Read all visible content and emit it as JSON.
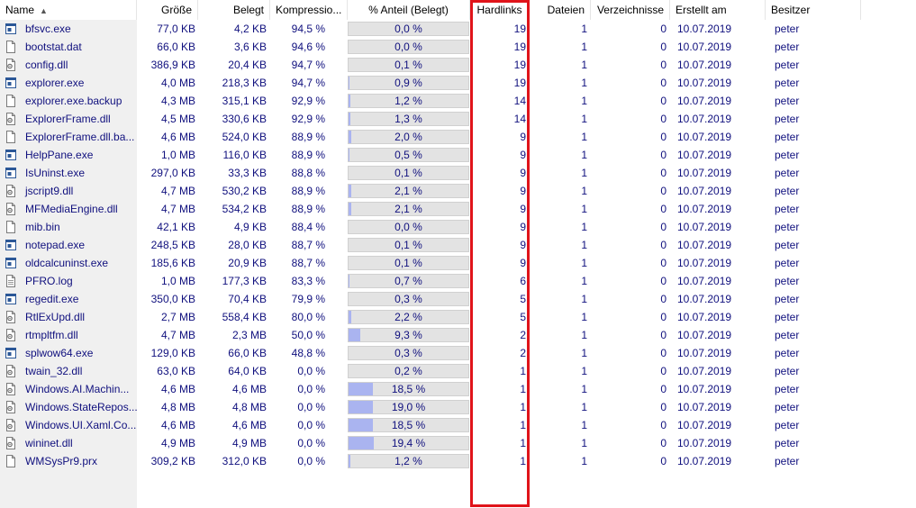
{
  "columns": {
    "name": "Name",
    "size": "Größe",
    "allocated": "Belegt",
    "compression": "Kompressio...",
    "share": "% Anteil (Belegt)",
    "hardlinks": "Hardlinks",
    "files": "Dateien",
    "directories": "Verzeichnisse",
    "created": "Erstellt am",
    "owner": "Besitzer"
  },
  "sort": {
    "column": "name",
    "direction": "ascending"
  },
  "accent_colors": {
    "text": "#10107e",
    "bar": "#aab4f0",
    "highlight": "#e0141a"
  },
  "rows": [
    {
      "icon": "app-file-icon",
      "name": "bfsvc.exe",
      "size": "77,0 KB",
      "allocated": "4,2 KB",
      "compression": "94,5 %",
      "share": "0,0 %",
      "share_value": 0.0,
      "hardlinks": "19",
      "files": "1",
      "directories": "0",
      "created": "10.07.2019",
      "owner": "peter"
    },
    {
      "icon": "text-file-icon",
      "name": "bootstat.dat",
      "size": "66,0 KB",
      "allocated": "3,6 KB",
      "compression": "94,6 %",
      "share": "0,0 %",
      "share_value": 0.0,
      "hardlinks": "19",
      "files": "1",
      "directories": "0",
      "created": "10.07.2019",
      "owner": "peter"
    },
    {
      "icon": "dll-file-icon",
      "name": "config.dll",
      "size": "386,9 KB",
      "allocated": "20,4 KB",
      "compression": "94,7 %",
      "share": "0,1 %",
      "share_value": 0.1,
      "hardlinks": "19",
      "files": "1",
      "directories": "0",
      "created": "10.07.2019",
      "owner": "peter"
    },
    {
      "icon": "app-file-icon",
      "name": "explorer.exe",
      "size": "4,0 MB",
      "allocated": "218,3 KB",
      "compression": "94,7 %",
      "share": "0,9 %",
      "share_value": 0.9,
      "hardlinks": "19",
      "files": "1",
      "directories": "0",
      "created": "10.07.2019",
      "owner": "peter"
    },
    {
      "icon": "text-file-icon",
      "name": "explorer.exe.backup",
      "size": "4,3 MB",
      "allocated": "315,1 KB",
      "compression": "92,9 %",
      "share": "1,2 %",
      "share_value": 1.2,
      "hardlinks": "14",
      "files": "1",
      "directories": "0",
      "created": "10.07.2019",
      "owner": "peter"
    },
    {
      "icon": "dll-file-icon",
      "name": "ExplorerFrame.dll",
      "size": "4,5 MB",
      "allocated": "330,6 KB",
      "compression": "92,9 %",
      "share": "1,3 %",
      "share_value": 1.3,
      "hardlinks": "14",
      "files": "1",
      "directories": "0",
      "created": "10.07.2019",
      "owner": "peter"
    },
    {
      "icon": "text-file-icon",
      "name": "ExplorerFrame.dll.ba...",
      "size": "4,6 MB",
      "allocated": "524,0 KB",
      "compression": "88,9 %",
      "share": "2,0 %",
      "share_value": 2.0,
      "hardlinks": "9",
      "files": "1",
      "directories": "0",
      "created": "10.07.2019",
      "owner": "peter"
    },
    {
      "icon": "app-file-icon",
      "name": "HelpPane.exe",
      "size": "1,0 MB",
      "allocated": "116,0 KB",
      "compression": "88,9 %",
      "share": "0,5 %",
      "share_value": 0.5,
      "hardlinks": "9",
      "files": "1",
      "directories": "0",
      "created": "10.07.2019",
      "owner": "peter"
    },
    {
      "icon": "app-file-icon",
      "name": "IsUninst.exe",
      "size": "297,0 KB",
      "allocated": "33,3 KB",
      "compression": "88,8 %",
      "share": "0,1 %",
      "share_value": 0.1,
      "hardlinks": "9",
      "files": "1",
      "directories": "0",
      "created": "10.07.2019",
      "owner": "peter"
    },
    {
      "icon": "dll-file-icon",
      "name": "jscript9.dll",
      "size": "4,7 MB",
      "allocated": "530,2 KB",
      "compression": "88,9 %",
      "share": "2,1 %",
      "share_value": 2.1,
      "hardlinks": "9",
      "files": "1",
      "directories": "0",
      "created": "10.07.2019",
      "owner": "peter"
    },
    {
      "icon": "dll-file-icon",
      "name": "MFMediaEngine.dll",
      "size": "4,7 MB",
      "allocated": "534,2 KB",
      "compression": "88,9 %",
      "share": "2,1 %",
      "share_value": 2.1,
      "hardlinks": "9",
      "files": "1",
      "directories": "0",
      "created": "10.07.2019",
      "owner": "peter"
    },
    {
      "icon": "text-file-icon",
      "name": "mib.bin",
      "size": "42,1 KB",
      "allocated": "4,9 KB",
      "compression": "88,4 %",
      "share": "0,0 %",
      "share_value": 0.0,
      "hardlinks": "9",
      "files": "1",
      "directories": "0",
      "created": "10.07.2019",
      "owner": "peter"
    },
    {
      "icon": "app-file-icon",
      "name": "notepad.exe",
      "size": "248,5 KB",
      "allocated": "28,0 KB",
      "compression": "88,7 %",
      "share": "0,1 %",
      "share_value": 0.1,
      "hardlinks": "9",
      "files": "1",
      "directories": "0",
      "created": "10.07.2019",
      "owner": "peter"
    },
    {
      "icon": "app-file-icon",
      "name": "oldcalcuninst.exe",
      "size": "185,6 KB",
      "allocated": "20,9 KB",
      "compression": "88,7 %",
      "share": "0,1 %",
      "share_value": 0.1,
      "hardlinks": "9",
      "files": "1",
      "directories": "0",
      "created": "10.07.2019",
      "owner": "peter"
    },
    {
      "icon": "log-file-icon",
      "name": "PFRO.log",
      "size": "1,0 MB",
      "allocated": "177,3 KB",
      "compression": "83,3 %",
      "share": "0,7 %",
      "share_value": 0.7,
      "hardlinks": "6",
      "files": "1",
      "directories": "0",
      "created": "10.07.2019",
      "owner": "peter"
    },
    {
      "icon": "app-file-icon",
      "name": "regedit.exe",
      "size": "350,0 KB",
      "allocated": "70,4 KB",
      "compression": "79,9 %",
      "share": "0,3 %",
      "share_value": 0.3,
      "hardlinks": "5",
      "files": "1",
      "directories": "0",
      "created": "10.07.2019",
      "owner": "peter"
    },
    {
      "icon": "dll-file-icon",
      "name": "RtlExUpd.dll",
      "size": "2,7 MB",
      "allocated": "558,4 KB",
      "compression": "80,0 %",
      "share": "2,2 %",
      "share_value": 2.2,
      "hardlinks": "5",
      "files": "1",
      "directories": "0",
      "created": "10.07.2019",
      "owner": "peter"
    },
    {
      "icon": "dll-file-icon",
      "name": "rtmpltfm.dll",
      "size": "4,7 MB",
      "allocated": "2,3 MB",
      "compression": "50,0 %",
      "share": "9,3 %",
      "share_value": 9.3,
      "hardlinks": "2",
      "files": "1",
      "directories": "0",
      "created": "10.07.2019",
      "owner": "peter"
    },
    {
      "icon": "app-file-icon",
      "name": "splwow64.exe",
      "size": "129,0 KB",
      "allocated": "66,0 KB",
      "compression": "48,8 %",
      "share": "0,3 %",
      "share_value": 0.3,
      "hardlinks": "2",
      "files": "1",
      "directories": "0",
      "created": "10.07.2019",
      "owner": "peter"
    },
    {
      "icon": "dll-file-icon",
      "name": "twain_32.dll",
      "size": "63,0 KB",
      "allocated": "64,0 KB",
      "compression": "0,0 %",
      "share": "0,2 %",
      "share_value": 0.2,
      "hardlinks": "1",
      "files": "1",
      "directories": "0",
      "created": "10.07.2019",
      "owner": "peter"
    },
    {
      "icon": "dll-file-icon",
      "name": "Windows.AI.Machin...",
      "size": "4,6 MB",
      "allocated": "4,6 MB",
      "compression": "0,0 %",
      "share": "18,5 %",
      "share_value": 18.5,
      "hardlinks": "1",
      "files": "1",
      "directories": "0",
      "created": "10.07.2019",
      "owner": "peter"
    },
    {
      "icon": "dll-file-icon",
      "name": "Windows.StateRepos...",
      "size": "4,8 MB",
      "allocated": "4,8 MB",
      "compression": "0,0 %",
      "share": "19,0 %",
      "share_value": 19.0,
      "hardlinks": "1",
      "files": "1",
      "directories": "0",
      "created": "10.07.2019",
      "owner": "peter"
    },
    {
      "icon": "dll-file-icon",
      "name": "Windows.UI.Xaml.Co...",
      "size": "4,6 MB",
      "allocated": "4,6 MB",
      "compression": "0,0 %",
      "share": "18,5 %",
      "share_value": 18.5,
      "hardlinks": "1",
      "files": "1",
      "directories": "0",
      "created": "10.07.2019",
      "owner": "peter"
    },
    {
      "icon": "dll-file-icon",
      "name": "wininet.dll",
      "size": "4,9 MB",
      "allocated": "4,9 MB",
      "compression": "0,0 %",
      "share": "19,4 %",
      "share_value": 19.4,
      "hardlinks": "1",
      "files": "1",
      "directories": "0",
      "created": "10.07.2019",
      "owner": "peter"
    },
    {
      "icon": "text-file-icon",
      "name": "WMSysPr9.prx",
      "size": "309,2 KB",
      "allocated": "312,0 KB",
      "compression": "0,0 %",
      "share": "1,2 %",
      "share_value": 1.2,
      "hardlinks": "1",
      "files": "1",
      "directories": "0",
      "created": "10.07.2019",
      "owner": "peter"
    }
  ]
}
